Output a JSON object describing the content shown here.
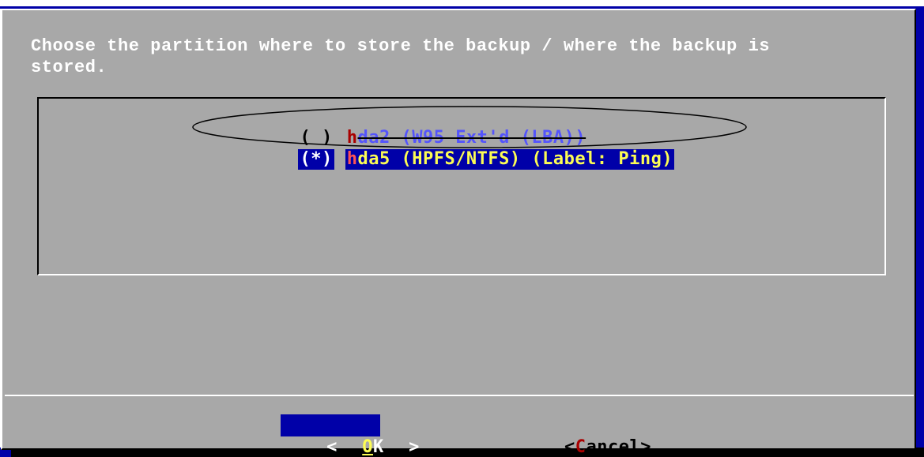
{
  "dialog": {
    "prompt": "Choose the partition where to store the backup / where the backup is\nstored."
  },
  "partitions": [
    {
      "radio": "( )",
      "hotkey": "h",
      "rest": "da2 (W95 Ext'd (LBA))",
      "selected": false
    },
    {
      "radio": "(*)",
      "hotkey": "h",
      "rest": "da5 (HPFS/NTFS) (Label: Ping)",
      "selected": true
    }
  ],
  "buttons": {
    "ok": {
      "open": "<",
      "label_hot": "O",
      "label_rest": "K",
      "close": ">"
    },
    "cancel": {
      "open": "<",
      "hot": "C",
      "rest": "ancel",
      "close": ">"
    }
  },
  "colors": {
    "dialog_bg": "#a8a8a8",
    "highlight_bg": "#0000a8",
    "hotkey": "#a80000",
    "selected_text": "#fcfc54",
    "disabled_text": "#5454fc"
  }
}
